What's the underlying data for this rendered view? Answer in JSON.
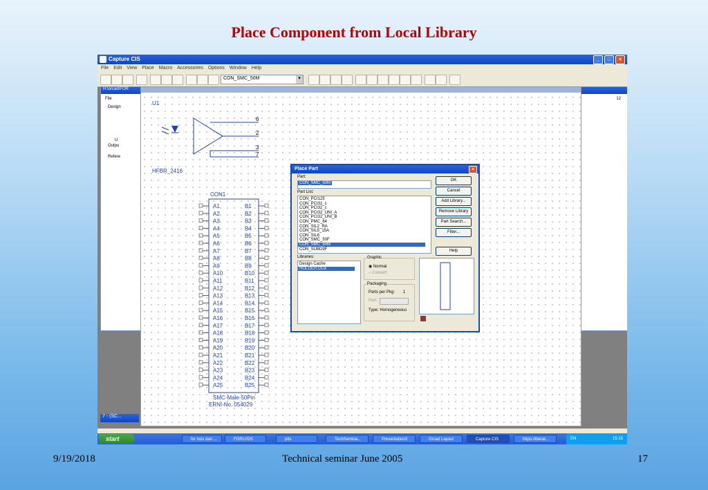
{
  "slide": {
    "title": "Place Component from Local Library",
    "footer_date": "9/19/2018",
    "footer_center": "Technical seminar June 2005",
    "footer_page": "17"
  },
  "app": {
    "title": "Capture CIS",
    "menu": [
      "File",
      "Edit",
      "View",
      "Place",
      "Macro",
      "Accessories",
      "Options",
      "Window",
      "Help"
    ],
    "part_combo_value": "CON_SMC_50M",
    "window_buttons": [
      "_",
      "□",
      "×"
    ]
  },
  "project_panel": {
    "title": "H:\\orcad\\FOR",
    "tab": "File",
    "tree": [
      "Design",
      "",
      "",
      "",
      "U",
      "Outpu",
      "",
      "Refere"
    ]
  },
  "schematic": {
    "u1": {
      "ref": "U1",
      "name": "HFBR_2416",
      "pins": [
        "6",
        "2",
        "3",
        "7"
      ]
    },
    "con1": {
      "ref": "CON1",
      "a_pins": [
        "A1",
        "A2",
        "A3",
        "A4",
        "A5",
        "A6",
        "A7",
        "A8",
        "A9",
        "A10",
        "A11",
        "A12",
        "A13",
        "A14",
        "A15",
        "A16",
        "A17",
        "A18",
        "A19",
        "A20",
        "A21",
        "A22",
        "A23",
        "A24",
        "A25"
      ],
      "b_pins": [
        "B1",
        "B2",
        "B3",
        "B4",
        "B5",
        "B6",
        "B7",
        "B8",
        "B9",
        "B10",
        "B11",
        "B12",
        "B13",
        "B14",
        "B15",
        "B16",
        "B17",
        "B18",
        "B19",
        "B20",
        "B21",
        "B22",
        "B23",
        "B24",
        "B25"
      ],
      "label1": "SMC-Male-50Pin",
      "label2": "ERNI-No. 054029"
    },
    "zoom_label": "12"
  },
  "dialog": {
    "title": "Place Part",
    "part_label": "Part:",
    "part_value": "CON_SMC_50M",
    "part_list_label": "Part List:",
    "part_list": [
      "CON_PCI125",
      "CON_PCI32_c",
      "CON_PCI32_c",
      "CON_PCI32_UNI_A",
      "CON_PCI32_UNI_B",
      "CON_PMC_64",
      "CON_SIL2_RA",
      "CON_SIL5_15A",
      "CON_SIL6",
      "CON_SMC_50F",
      "CON_SMC_50M",
      "CON_SUBD9F"
    ],
    "selected_part_index": 10,
    "libraries_label": "Libraries:",
    "libraries": [
      "Design Cache",
      "HOLGER.OLB"
    ],
    "selected_library_index": 1,
    "graphic_label": "Graphic",
    "graphic_normal": "Normal",
    "graphic_convert": "Convert",
    "packaging_label": "Packaging",
    "parts_per_pkg_label": "Parts per Pkg:",
    "parts_per_pkg_value": "1",
    "part_label2": "Part:",
    "type_label": "Type: Homogeneous",
    "buttons": [
      "OK",
      "Cancel",
      "Add Library...",
      "Remove Library",
      "Part Search...",
      "Filter...",
      "Help"
    ]
  },
  "taskbar": {
    "start": "start",
    "tasks": [
      "for lvds dan ...",
      "FORLVDS",
      "pits",
      "TechSemina...",
      "Presentation3",
      "Orcad Layout",
      "Capture CIS",
      "https://iberat..."
    ],
    "active_task_index": 6,
    "lang": "EN",
    "clock": "15:15"
  },
  "bottom_window": "7 - (SC..."
}
